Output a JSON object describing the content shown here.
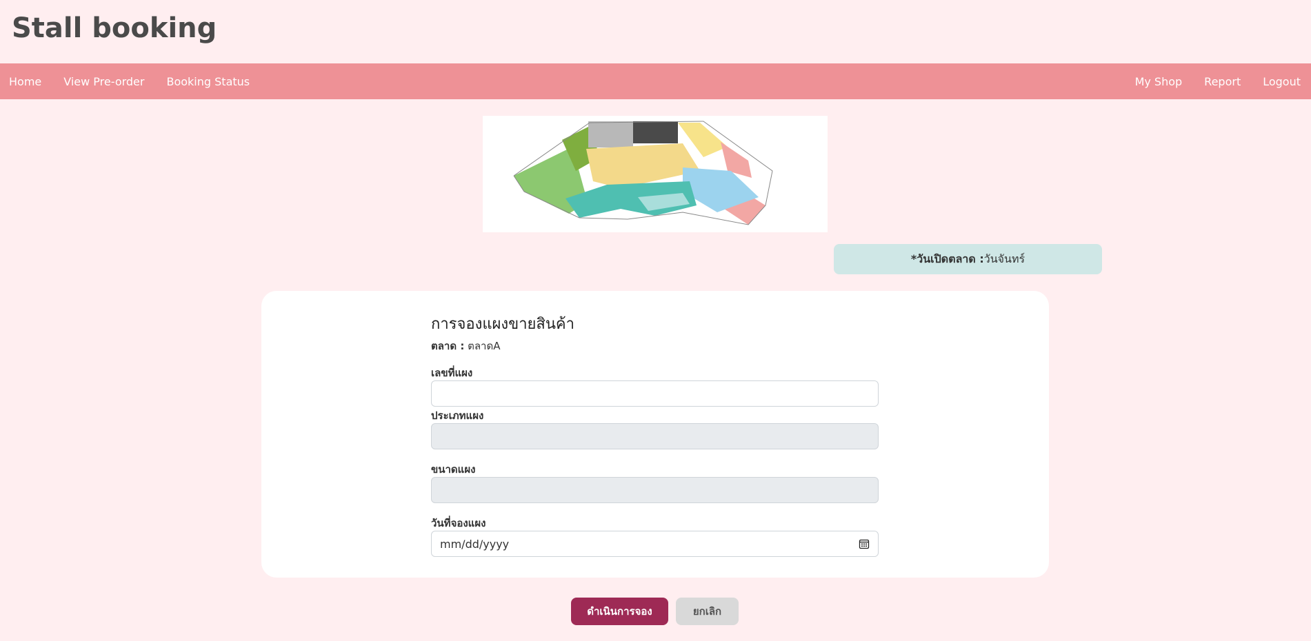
{
  "header": {
    "title": "Stall booking"
  },
  "nav": {
    "left": [
      "Home",
      "View Pre-order",
      "Booking Status"
    ],
    "right": [
      "My Shop",
      "Report",
      "Logout"
    ]
  },
  "market_open": {
    "label": "*วันเปิดตลาด :",
    "value": "วันจันทร์"
  },
  "form": {
    "title": "การจองแผงขายสินค้า",
    "market_label": "ตลาด :",
    "market_value": "ตลาดA",
    "stall_no_label": "เลขที่แผง",
    "stall_no_value": "",
    "stall_type_label": "ประเภทแผง",
    "stall_type_value": "",
    "stall_size_label": "ขนาดแผง",
    "stall_size_value": "",
    "date_label": "วันที่จองแผง",
    "date_placeholder": "mm/dd/yyyy"
  },
  "buttons": {
    "submit": "ดำเนินการจอง",
    "cancel": "ยกเลิก"
  },
  "icons": {
    "date": "calendar-icon"
  },
  "colors": {
    "background": "#ffeef0",
    "navbar": "#ee9196",
    "primary_button": "#9e2a55",
    "notice": "#cfe7e6"
  }
}
